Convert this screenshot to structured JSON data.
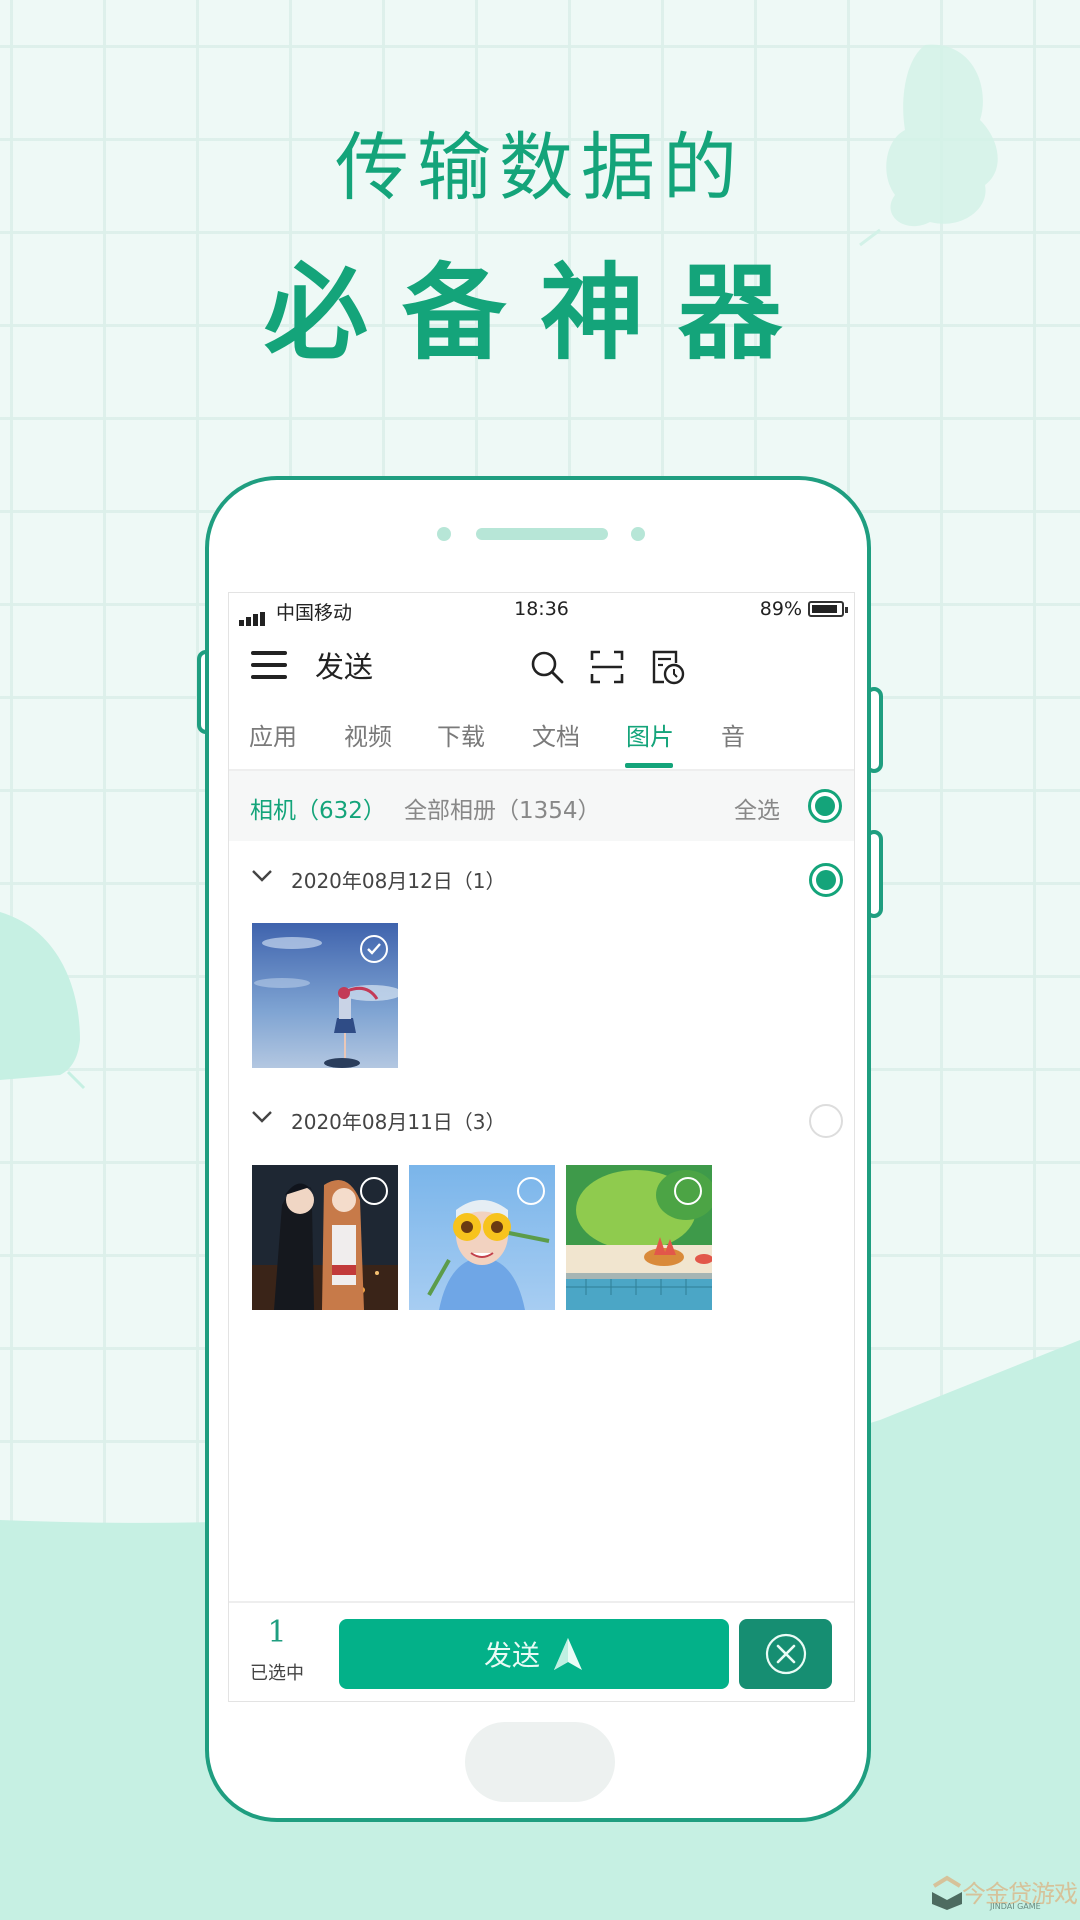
{
  "promo": {
    "headline_line1": "传输数据的",
    "headline_line2": "必备神器",
    "accent_color": "#14a47a",
    "watermark_text": "今金贷游戏",
    "watermark_sub": "JINDAI GAME"
  },
  "status_bar": {
    "carrier": "中国移动",
    "time": "18:36",
    "battery": "89%",
    "battery_level": 0.89
  },
  "header": {
    "title": "发送",
    "icons": [
      "menu-icon",
      "search-icon",
      "scan-icon",
      "history-icon"
    ]
  },
  "tabs": [
    {
      "label": "应用",
      "active": false
    },
    {
      "label": "视频",
      "active": false
    },
    {
      "label": "下载",
      "active": false
    },
    {
      "label": "文档",
      "active": false
    },
    {
      "label": "图片",
      "active": true
    },
    {
      "label": "音",
      "active": false
    }
  ],
  "filter": {
    "camera": "相机（632）",
    "all_albums": "全部相册（1354）",
    "select_all": "全选",
    "select_all_checked": true
  },
  "groups": [
    {
      "date": "2020年08月12日（1）",
      "checked": true,
      "photos": [
        {
          "name": "anime-girl-sky",
          "checked": true
        }
      ]
    },
    {
      "date": "2020年08月11日（3）",
      "checked": false,
      "photos": [
        {
          "name": "anime-couple-night",
          "checked": false
        },
        {
          "name": "sunflower-glasses",
          "checked": false
        },
        {
          "name": "watermelon-pool",
          "checked": false
        }
      ]
    }
  ],
  "bottom_bar": {
    "selected_count": "1",
    "selected_label": "已选中",
    "send_label": "发送",
    "primary_color": "#03b189",
    "cancel_color": "#168e72"
  }
}
